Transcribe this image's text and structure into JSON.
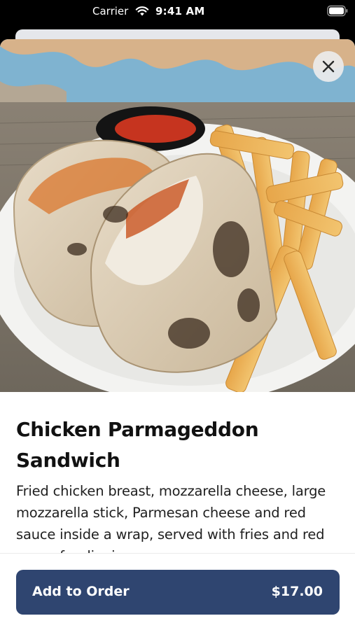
{
  "status_bar": {
    "carrier": "Carrier",
    "time": "9:41 AM",
    "wifi_icon": "wifi-icon",
    "battery_icon": "battery-icon"
  },
  "item": {
    "image_description_icon": "food-photo",
    "title": "Chicken Parmageddon Sandwich",
    "description": "Fried chicken breast, mozzarella cheese, large mozzarella stick, Parmesan cheese and red sauce inside a wrap, served with fries and red sauce for dipping"
  },
  "close_icon": "close-icon",
  "order_button": {
    "label": "Add to Order",
    "price": "$17.00",
    "color": "#2f4570"
  }
}
